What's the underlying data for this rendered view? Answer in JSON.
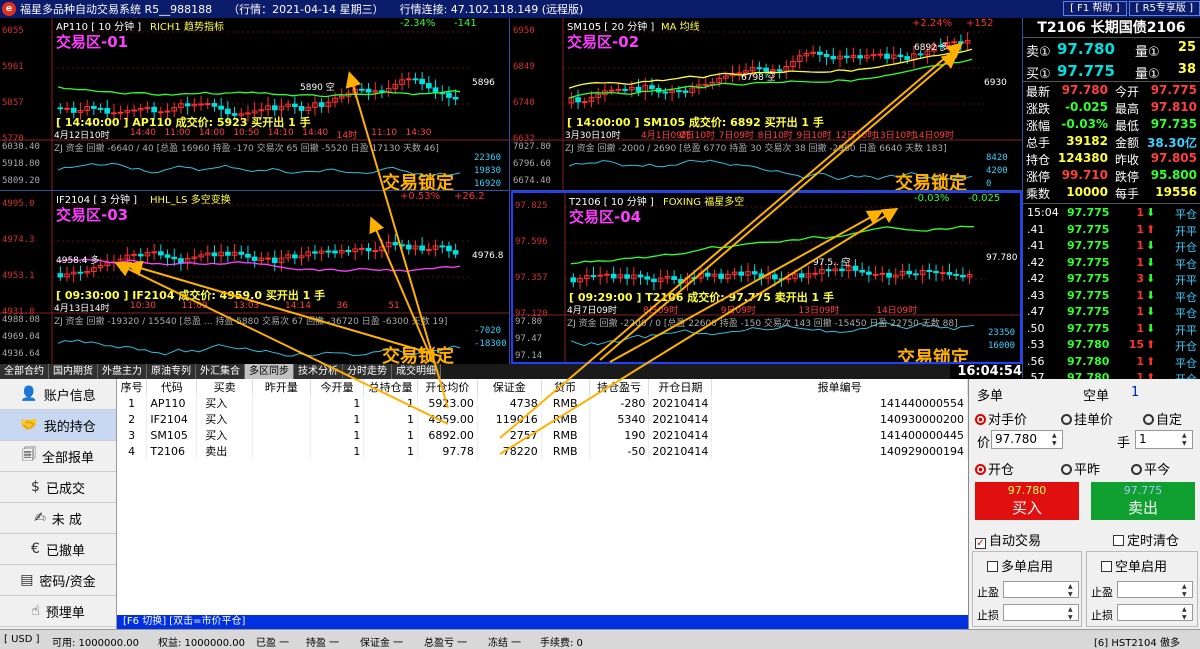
{
  "titlebar": {
    "app_title": "福星多品种自动交易系统 R5__988188",
    "market": "（行情：2021-04-14 星期三）",
    "connection": "行情连接: 47.102.118.149 (远程版)",
    "help_button": "[ F1 帮助 ]",
    "edition_button": "[ R5专享版 ]"
  },
  "charts": [
    {
      "id": "p1",
      "title_left": "AP110 [ 10 分钟 ]",
      "title_indicator": "RICH1 趋势指标",
      "change": "-2.34%",
      "change_points": "-141",
      "zone": "交易区-01",
      "y_labels": [
        "6055",
        "5961",
        "5857",
        "5770"
      ],
      "last_price": "5896",
      "annotation": "5890 空",
      "yellow_info": "[ 14:40:00 ] AP110 成交价: 5923 买开出 1 手",
      "time_axis": "4月12日10时",
      "time_ticks": [
        "14:40",
        "11:00",
        "14:00",
        "10:50",
        "14:10",
        "14:40",
        "14时",
        "11:10",
        "14:30"
      ],
      "indicator_text": "ZJ 资金 回撤 -6640 / 40 [总盈 16960 持盈 -170 交易次 65 回撤 -5520 日盈 17130 天数 46]",
      "ind_y": [
        "6030.40",
        "5918.80",
        "5809.20"
      ],
      "ind_r": [
        "22360",
        "19830",
        "16920"
      ],
      "lock": "交易锁定"
    },
    {
      "id": "p2",
      "title_left": "SM105 [ 20 分钟 ]",
      "title_indicator": "MA 均线",
      "change": "+2.24%",
      "change_points": "+152",
      "zone": "交易区-02",
      "y_labels": [
        "6950",
        "6849",
        "6740",
        "6632"
      ],
      "last_price": "6930",
      "annotation": "6892 多",
      "annotation2": "6798 空",
      "yellow_info": "[ 14:00:00 ] SM105 成交价: 6892 买开出 1 手",
      "time_axis": "3月30日10时",
      "time_ticks": [
        "4月1日09时",
        "2日10时",
        "7日09时",
        "8日10时",
        "9日10时",
        "12日10时",
        "13日10时",
        "14日09时"
      ],
      "indicator_text": "ZJ 资金 回撤 -2000 / 2690 [总盈 6770 持盈 30 交易次 38 回撤 -2960 日盈 6640 天数 183]",
      "ind_y": [
        "7027.80",
        "6796.60",
        "6674.40"
      ],
      "ind_r": [
        "8420",
        "4200",
        "0"
      ],
      "lock": "交易锁定"
    },
    {
      "id": "p3",
      "title_left": "IF2104 [ 3 分钟 ]",
      "title_indicator": "HHL_LS 多空变换",
      "change": "+0.53%",
      "change_points": "+26.2",
      "zone": "交易区-03",
      "y_labels": [
        "4995.0",
        "4974.3",
        "4953.1",
        "4931.8"
      ],
      "last_price": "4976.8",
      "annotation": "4958.4 多",
      "yellow_info": "[ 09:30:00 ] IF2104 成交价: 4959.0 买开出 1 手",
      "time_axis": "4月13日14时",
      "time_ticks": [
        "10:30",
        "11:09",
        "13:03",
        "14:14",
        "36",
        "51"
      ],
      "indicator_text": "ZJ 资金 回撤 -19320 / 15540 [总盈 ... 持盈 5880 交易次 67 回撤 -36720 日盈 -6300 天数 19]",
      "ind_y": [
        "4988.08",
        "4969.04",
        "4936.64"
      ],
      "ind_r": [
        "-7020",
        "-18300"
      ],
      "lock": "交易锁定"
    },
    {
      "id": "p4",
      "title_left": "T2106 [ 10 分钟 ]",
      "title_indicator": "FOXING 福星多空",
      "change": "-0.03%",
      "change_points": "-0.025",
      "zone": "交易区-04",
      "y_labels": [
        "97.825",
        "97.596",
        "97.357",
        "97.120"
      ],
      "last_price": "97.780",
      "annotation": "97.5.. 空",
      "yellow_info": "[ 09:29:00 ] T2106 成交价: 97.775 卖开出 1 手",
      "time_axis": "4月7日09时",
      "time_ticks": [
        "8日09时",
        "9日09时",
        "13日09时",
        "14日09时"
      ],
      "indicator_text": "ZJ 资金 回撤 -2200 / 0 [总盈 22600 持盈 -150 交易次 143 回撤 -15450 日盈 22750 天数 88]",
      "ind_y": [
        "97.80",
        "97.47",
        "97.14"
      ],
      "ind_r": [
        "23350",
        "16000"
      ],
      "lock": "交易锁定"
    }
  ],
  "quote": {
    "title": "T2106 长期国债2106",
    "sell": {
      "label": "卖①",
      "price": "97.780",
      "vol_label": "量①",
      "vol": "25"
    },
    "buy": {
      "label": "买①",
      "price": "97.775",
      "vol_label": "量①",
      "vol": "38"
    },
    "stats": [
      {
        "l": "最新",
        "v": "97.780",
        "l2": "今开",
        "v2": "97.775"
      },
      {
        "l": "涨跌",
        "v": "-0.025",
        "l2": "最高",
        "v2": "97.810"
      },
      {
        "l": "涨幅",
        "v": "-0.03%",
        "l2": "最低",
        "v2": "97.735"
      },
      {
        "l": "总手",
        "v": "39182",
        "l2": "金额",
        "v2": "38.30亿"
      },
      {
        "l": "持仓",
        "v": "124380",
        "l2": "昨收",
        "v2": "97.805"
      },
      {
        "l": "涨停",
        "v": "99.710",
        "l2": "跌停",
        "v2": "95.800"
      },
      {
        "l": "乘数",
        "v": "10000",
        "l2": "每手",
        "v2": "19556"
      }
    ],
    "ticks": [
      {
        "t": "15:04",
        "p": "97.775",
        "v": "1",
        "d": "down",
        "a": "平仓"
      },
      {
        "t": ".41",
        "p": "97.775",
        "v": "1",
        "d": "up",
        "a": "开平"
      },
      {
        "t": ".41",
        "p": "97.775",
        "v": "1",
        "d": "down",
        "a": "开仓"
      },
      {
        "t": ".42",
        "p": "97.775",
        "v": "1",
        "d": "down",
        "a": "平仓"
      },
      {
        "t": ".42",
        "p": "97.775",
        "v": "3",
        "d": "down",
        "a": "开平"
      },
      {
        "t": ".43",
        "p": "97.775",
        "v": "1",
        "d": "down",
        "a": "平仓"
      },
      {
        "t": ".47",
        "p": "97.775",
        "v": "1",
        "d": "down",
        "a": "平仓"
      },
      {
        "t": ".50",
        "p": "97.775",
        "v": "1",
        "d": "down",
        "a": "开平"
      },
      {
        "t": ".53",
        "p": "97.780",
        "v": "15",
        "d": "up",
        "a": "开仓"
      },
      {
        "t": ".56",
        "p": "97.780",
        "v": "1",
        "d": "up",
        "a": "平仓"
      },
      {
        "t": ".57",
        "p": "97.780",
        "v": "1",
        "d": "up",
        "a": "开仓"
      }
    ]
  },
  "tabs": [
    "全部合约",
    "国内期货",
    "外盘主力",
    "原油专列",
    "外汇集合",
    "多区同步",
    "技术分析",
    "分时走势",
    "成交明细"
  ],
  "active_tab": 5,
  "clock": "16:04:54",
  "nav": [
    {
      "label": "账户信息",
      "icon": "account-icon",
      "glyph": "👤"
    },
    {
      "label": "我的持仓",
      "icon": "holdings-icon",
      "glyph": "🤝"
    },
    {
      "label": "全部报单",
      "icon": "orders-icon",
      "glyph": "🗐"
    },
    {
      "label": "已成交",
      "icon": "filled-icon",
      "glyph": "$"
    },
    {
      "label": "未 成",
      "icon": "pending-icon",
      "glyph": "✍"
    },
    {
      "label": "已撤单",
      "icon": "cancelled-icon",
      "glyph": "€"
    },
    {
      "label": "密码/资金",
      "icon": "password-icon",
      "glyph": "▤"
    },
    {
      "label": "预埋单",
      "icon": "preset-icon",
      "glyph": "☝"
    }
  ],
  "active_nav": 1,
  "table": {
    "headers": [
      "序号",
      "代码",
      "买卖",
      "昨开量",
      "今开量",
      "总持仓量",
      "开仓均价",
      "保证金",
      "货币",
      "持仓盈亏",
      "开仓日期",
      "报单编号"
    ],
    "rows": [
      [
        "1",
        "AP110",
        "买入",
        "",
        "1",
        "1",
        "5923.00",
        "4738",
        "RMB",
        "-280",
        "20210414",
        "141440000554"
      ],
      [
        "2",
        "IF2104",
        "买入",
        "",
        "1",
        "1",
        "4959.00",
        "119016",
        "RMB",
        "5340",
        "20210414",
        "140930000200"
      ],
      [
        "3",
        "SM105",
        "买入",
        "",
        "1",
        "1",
        "6892.00",
        "2757",
        "RMB",
        "190",
        "20210414",
        "141400000445"
      ],
      [
        "4",
        "T2106",
        "卖出",
        "",
        "1",
        "1",
        "97.78",
        "78220",
        "RMB",
        "-50",
        "20210414",
        "140929000194"
      ]
    ]
  },
  "table_hint": "[F6 切换] [双击=市价平仓]",
  "order": {
    "long_label": "多单",
    "short_label": "空单",
    "short_count": "1",
    "price_modes": [
      "对手价",
      "挂单价",
      "自定"
    ],
    "price_label": "价",
    "price_value": "97.780",
    "qty_label": "手",
    "qty_value": "1",
    "actions": [
      "开仓",
      "平昨",
      "平今"
    ],
    "buy_price": "97.780",
    "buy_label": "买入",
    "sell_price": "97.775",
    "sell_label": "卖出",
    "auto_trade": "自动交易",
    "timed_clear": "定时清仓",
    "long_enable": "多单启用",
    "short_enable": "空单启用",
    "take_profit": "止盈",
    "stop_loss": "止损"
  },
  "status": {
    "currency": "[ USD ]",
    "available": "可用: 1000000.00",
    "equity": "权益: 1000000.00",
    "closed_pl": "已盈 一",
    "hold_pl": "持盈 一",
    "margin": "保证金 一",
    "total_pl": "总盈亏 一",
    "frozen": "冻结 一",
    "fee": "手续费: 0",
    "right": "[6] HST2104 傲多"
  },
  "colors": {
    "up": "#ff3030",
    "down": "#00e0e0",
    "zone": "#ff3cff",
    "lock": "#ffb000",
    "buy_btn": "#e01010",
    "sell_btn": "#10a030"
  }
}
